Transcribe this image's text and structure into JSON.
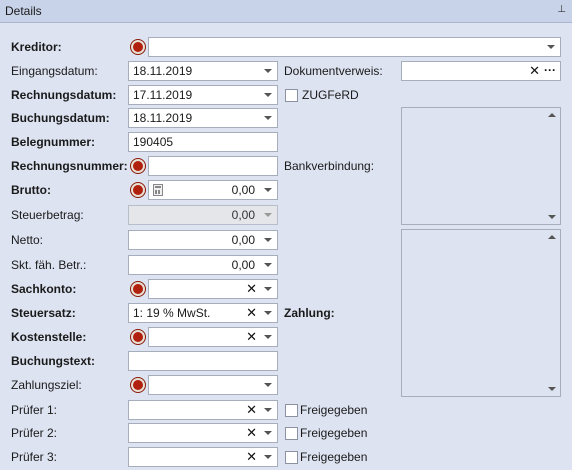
{
  "panel": {
    "title": "Details"
  },
  "left": {
    "kreditor": {
      "label": "Kreditor:",
      "value": ""
    },
    "eingangsdatum": {
      "label": "Eingangsdatum:",
      "value": "18.11.2019"
    },
    "rechnungsdatum": {
      "label": "Rechnungsdatum:",
      "value": "17.11.2019"
    },
    "buchungsdatum": {
      "label": "Buchungsdatum:",
      "value": "18.11.2019"
    },
    "belegnummer": {
      "label": "Belegnummer:",
      "value": "190405"
    },
    "rechnungsnummer": {
      "label": "Rechnungsnummer:",
      "value": ""
    },
    "brutto": {
      "label": "Brutto:",
      "value": "0,00"
    },
    "steuerbetrag": {
      "label": "Steuerbetrag:",
      "value": "0,00"
    },
    "netto": {
      "label": "Netto:",
      "value": "0,00"
    },
    "skonto": {
      "label": "Skt. fäh. Betr.:",
      "value": "0,00"
    },
    "sachkonto": {
      "label": "Sachkonto:",
      "value": ""
    },
    "steuersatz": {
      "label": "Steuersatz:",
      "value": "1: 19 % MwSt."
    },
    "kostenstelle": {
      "label": "Kostenstelle:",
      "value": ""
    },
    "buchungstext": {
      "label": "Buchungstext:",
      "value": ""
    },
    "zahlungsziel": {
      "label": "Zahlungsziel:",
      "value": ""
    },
    "pruefer1": {
      "label": "Prüfer 1:",
      "value": "",
      "check_label": "Freigegeben"
    },
    "pruefer2": {
      "label": "Prüfer 2:",
      "value": "",
      "check_label": "Freigegeben"
    },
    "pruefer3": {
      "label": "Prüfer 3:",
      "value": "",
      "check_label": "Freigegeben"
    }
  },
  "right": {
    "dokumentverweis": {
      "label": "Dokumentverweis:",
      "value": ""
    },
    "zugferd": {
      "label": "ZUGFeRD"
    },
    "bankverbindung": {
      "label": "Bankverbindung:"
    },
    "zahlung": {
      "label": "Zahlung:"
    }
  },
  "icons": {
    "clear": "✕",
    "more": "···",
    "pin": "⊥"
  },
  "colors": {
    "required_marker": "#b0200c",
    "panel_bg": "#dde3f1",
    "title_bg": "#c8d2e8"
  }
}
